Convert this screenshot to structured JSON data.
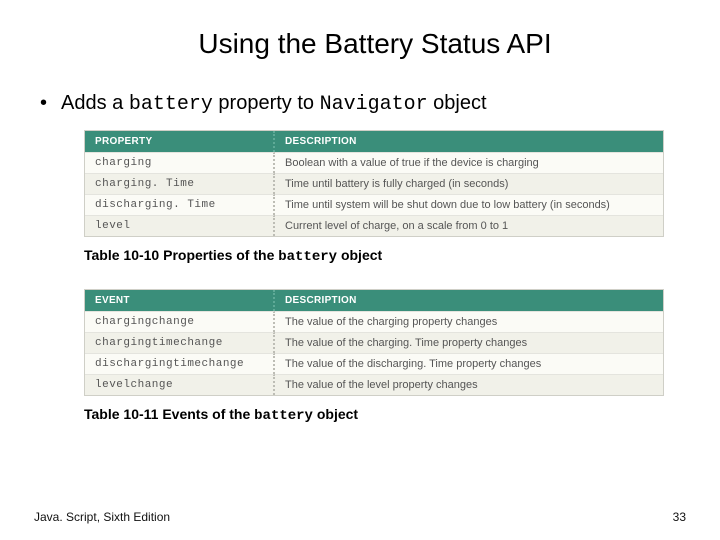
{
  "title": "Using the Battery Status API",
  "bullet": {
    "pre": "Adds a ",
    "code1": "battery",
    "mid": " property to ",
    "code2": "Navigator",
    "post": " object"
  },
  "table_props": {
    "head_left": "PROPERTY",
    "head_right": "DESCRIPTION",
    "rows": [
      {
        "name": "charging",
        "desc": "Boolean with a value of true if the device is charging"
      },
      {
        "name": "charging. Time",
        "desc": "Time until battery is fully charged (in seconds)"
      },
      {
        "name": "discharging. Time",
        "desc": "Time until system will be shut down due to low battery (in seconds)"
      },
      {
        "name": "level",
        "desc": "Current level of charge, on a scale from 0 to 1"
      }
    ]
  },
  "caption_props": {
    "pre": "Table 10-10 Properties of the ",
    "code": "battery",
    "post": " object"
  },
  "table_events": {
    "head_left": "EVENT",
    "head_right": "DESCRIPTION",
    "rows": [
      {
        "name": "chargingchange",
        "desc": "The value of the charging property changes"
      },
      {
        "name": "chargingtimechange",
        "desc": "The value of the charging. Time property changes"
      },
      {
        "name": "dischargingtimechange",
        "desc": "The value of the discharging. Time property changes"
      },
      {
        "name": "levelchange",
        "desc": "The value of the level property changes"
      }
    ]
  },
  "caption_events": {
    "pre": "Table 10-11 Events of the ",
    "code": "battery",
    "post": " object"
  },
  "footer_left": "Java. Script, Sixth Edition",
  "footer_right": "33"
}
